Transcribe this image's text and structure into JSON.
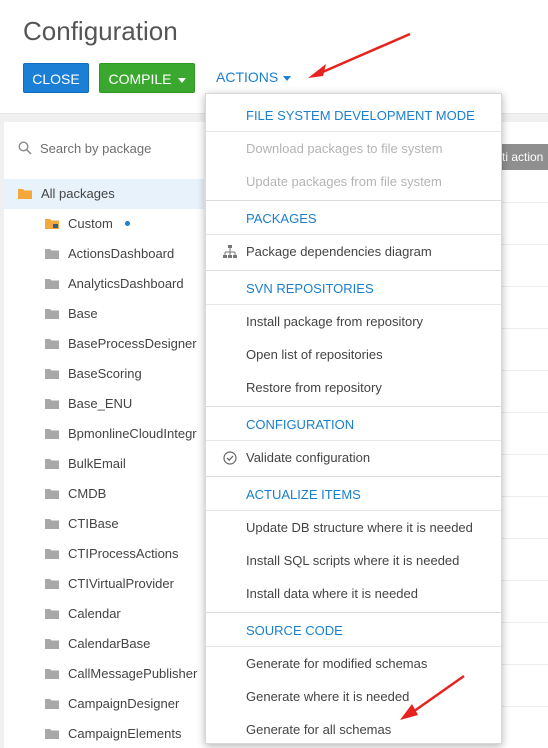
{
  "header": {
    "title": "Configuration",
    "close_label": "CLOSE",
    "compile_label": "COMPILE",
    "actions_label": "ACTIONS"
  },
  "search": {
    "placeholder": "Search by package"
  },
  "tree": {
    "root": "All packages",
    "items": [
      "Custom",
      "ActionsDashboard",
      "AnalyticsDashboard",
      "Base",
      "BaseProcessDesigner",
      "BaseScoring",
      "Base_ENU",
      "BpmonlineCloudIntegr",
      "BulkEmail",
      "CMDB",
      "CTIBase",
      "CTIProcessActions",
      "CTIVirtualProvider",
      "Calendar",
      "CalendarBase",
      "CallMessagePublisher",
      "CampaignDesigner",
      "CampaignElements"
    ]
  },
  "right_column": {
    "header_label": "ti action"
  },
  "menu": {
    "sections": [
      {
        "header": "FILE SYSTEM DEVELOPMENT MODE",
        "items": [
          {
            "label": "Download packages to file system",
            "state": "disabled"
          },
          {
            "label": "Update packages from file system",
            "state": "disabled"
          }
        ]
      },
      {
        "header": "PACKAGES",
        "items": [
          {
            "label": "Package dependencies diagram",
            "state": "normal",
            "icon": "hierarchy-icon"
          }
        ]
      },
      {
        "header": "SVN REPOSITORIES",
        "items": [
          {
            "label": "Install package from repository",
            "state": "normal"
          },
          {
            "label": "Open list of repositories",
            "state": "normal"
          },
          {
            "label": "Restore from repository",
            "state": "normal"
          }
        ]
      },
      {
        "header": "CONFIGURATION",
        "items": [
          {
            "label": "Validate configuration",
            "state": "normal",
            "icon": "check-circle-icon"
          }
        ]
      },
      {
        "header": "ACTUALIZE ITEMS",
        "items": [
          {
            "label": "Update DB structure where it is needed",
            "state": "normal"
          },
          {
            "label": "Install SQL scripts where it is needed",
            "state": "normal"
          },
          {
            "label": "Install data where it is needed",
            "state": "normal"
          }
        ]
      },
      {
        "header": "SOURCE CODE",
        "items": [
          {
            "label": "Generate for modified schemas",
            "state": "normal"
          },
          {
            "label": "Generate where it is needed",
            "state": "normal"
          },
          {
            "label": "Generate for all schemas",
            "state": "normal"
          }
        ]
      }
    ]
  },
  "colors": {
    "close_button": "#1c7fd6",
    "compile_button": "#3aa82e",
    "link_blue": "#1a7fd0",
    "annotation_arrow": "#e8231f",
    "folder": "#a8a8a8",
    "root_folder": "#f3a83b"
  }
}
